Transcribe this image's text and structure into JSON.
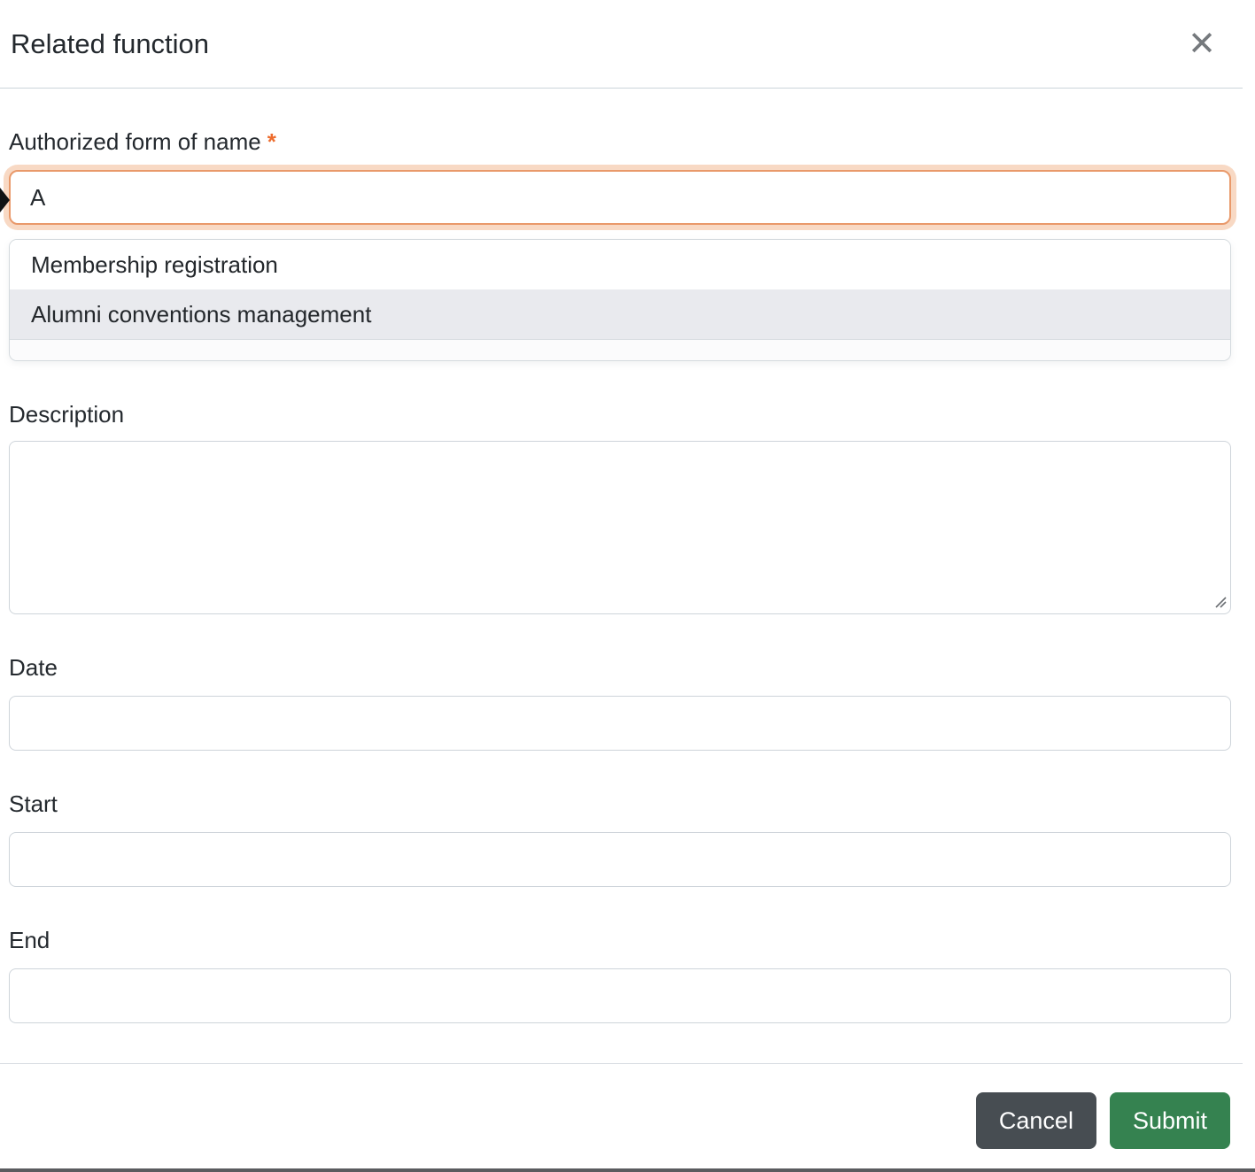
{
  "modal": {
    "title": "Related function",
    "close_glyph": "✕"
  },
  "form": {
    "name_field": {
      "label": "Authorized form of name",
      "required_marker": "*",
      "value": "A"
    },
    "autocomplete": {
      "options": [
        {
          "label": "Membership registration",
          "highlighted": false
        },
        {
          "label": "Alumni conventions management",
          "highlighted": true
        }
      ]
    },
    "description_field": {
      "label": "Description",
      "value": ""
    },
    "date_field": {
      "label": "Date",
      "value": ""
    },
    "start_field": {
      "label": "Start",
      "value": ""
    },
    "end_field": {
      "label": "End",
      "value": ""
    }
  },
  "footer": {
    "cancel_label": "Cancel",
    "submit_label": "Submit"
  },
  "colors": {
    "focus_border": "#e9996a",
    "focus_glow": "#f8d9c4",
    "required_marker": "#ed6c2d",
    "option_highlight": "#e9eaee",
    "cancel_button": "#474d52",
    "submit_button": "#358250",
    "divider": "#ccd4db"
  }
}
